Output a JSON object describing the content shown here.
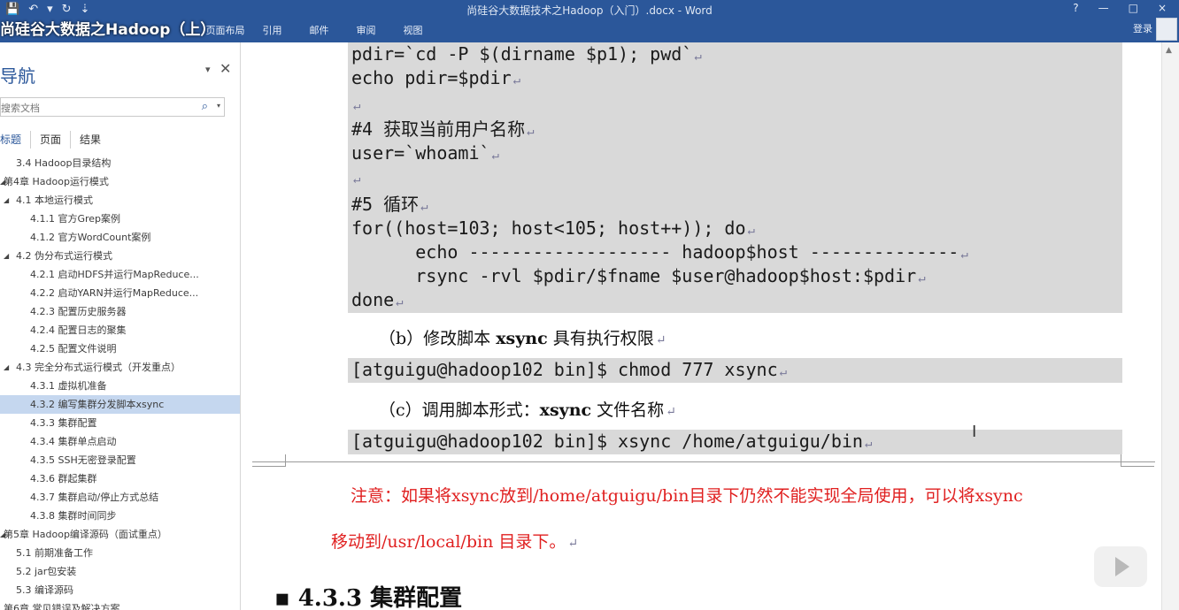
{
  "window": {
    "doc_title": "尚硅谷大数据技术之Hadoop（入门）.docx - Word",
    "video_title": "尚硅谷大数据之Hadoop（上）",
    "help": "?",
    "minimize": "—",
    "restore": "□",
    "close": "×",
    "account_label": "登录"
  },
  "qat": {
    "save": "💾",
    "undo": "↶",
    "undo_drop": "▾",
    "redo": "↻",
    "more": "⇣"
  },
  "ribbon_tabs": [
    "页面布局",
    "引用",
    "邮件",
    "审阅",
    "视图"
  ],
  "nav": {
    "title": "导航",
    "pin": "▾",
    "close": "✕",
    "search_placeholder": "搜索文档",
    "search_icon": "⌕",
    "search_drop": "▾",
    "tabs": [
      "标题",
      "页面",
      "结果"
    ],
    "outline": [
      {
        "text": "3.4 Hadoop目录结构",
        "indent": 1,
        "tri": ""
      },
      {
        "text": "第4章 Hadoop运行模式",
        "indent": 0,
        "tri": "◢"
      },
      {
        "text": "4.1 本地运行模式",
        "indent": 1,
        "tri": "◢"
      },
      {
        "text": "4.1.1 官方Grep案例",
        "indent": 2,
        "tri": ""
      },
      {
        "text": "4.1.2 官方WordCount案例",
        "indent": 2,
        "tri": ""
      },
      {
        "text": "4.2 伪分布式运行模式",
        "indent": 1,
        "tri": "◢"
      },
      {
        "text": "4.2.1 启动HDFS并运行MapReduce...",
        "indent": 2,
        "tri": ""
      },
      {
        "text": "4.2.2 启动YARN并运行MapReduce...",
        "indent": 2,
        "tri": ""
      },
      {
        "text": "4.2.3 配置历史服务器",
        "indent": 2,
        "tri": ""
      },
      {
        "text": "4.2.4 配置日志的聚集",
        "indent": 2,
        "tri": ""
      },
      {
        "text": "4.2.5 配置文件说明",
        "indent": 2,
        "tri": ""
      },
      {
        "text": "4.3 完全分布式运行模式（开发重点）",
        "indent": 1,
        "tri": "◢"
      },
      {
        "text": "4.3.1 虚拟机准备",
        "indent": 2,
        "tri": ""
      },
      {
        "text": "4.3.2 编写集群分发脚本xsync",
        "indent": 2,
        "tri": "",
        "selected": true
      },
      {
        "text": "4.3.3 集群配置",
        "indent": 2,
        "tri": ""
      },
      {
        "text": "4.3.4 集群单点启动",
        "indent": 2,
        "tri": ""
      },
      {
        "text": "4.3.5 SSH无密登录配置",
        "indent": 2,
        "tri": ""
      },
      {
        "text": "4.3.6 群起集群",
        "indent": 2,
        "tri": ""
      },
      {
        "text": "4.3.7 集群启动/停止方式总结",
        "indent": 2,
        "tri": ""
      },
      {
        "text": "4.3.8 集群时间同步",
        "indent": 2,
        "tri": ""
      },
      {
        "text": "第5章 Hadoop编译源码（面试重点）",
        "indent": 0,
        "tri": "◢"
      },
      {
        "text": "5.1 前期准备工作",
        "indent": 1,
        "tri": ""
      },
      {
        "text": "5.2 jar包安装",
        "indent": 1,
        "tri": ""
      },
      {
        "text": "5.3 编译源码",
        "indent": 1,
        "tri": ""
      },
      {
        "text": "第6章 常见错误及解决方案",
        "indent": 0,
        "tri": ""
      }
    ]
  },
  "doc": {
    "code_lines": [
      "pdir=`cd -P $(dirname $p1); pwd`",
      "echo pdir=$pdir",
      "",
      "#4 获取当前用户名称",
      "user=`whoami`",
      "",
      "#5 循环",
      "for((host=103; host<105; host++)); do",
      "      echo ------------------- hadoop$host --------------",
      "      rsync -rvl $pdir/$fname $user@hadoop$host:$pdir",
      "done"
    ],
    "step_b_prefix": "（b）修改脚本 ",
    "step_b_bold": "xsync",
    "step_b_suffix": " 具有执行权限",
    "cmd_chmod": "[atguigu@hadoop102 bin]$ chmod 777 xsync",
    "step_c_prefix": "（c）调用脚本形式：",
    "step_c_bold": "xsync",
    "step_c_suffix": " 文件名称",
    "cmd_xsync": "[atguigu@hadoop102 bin]$ xsync /home/atguigu/bin",
    "note_line1": "注意：如果将xsync放到/home/atguigu/bin目录下仍然不能实现全局使用，可以将xsync",
    "note_line2": "移动到/usr/local/bin 目录下。",
    "heading_bullet": "▪",
    "heading": "4.3.3  集群配置",
    "para_mark": "↵",
    "text_cursor": "I"
  }
}
